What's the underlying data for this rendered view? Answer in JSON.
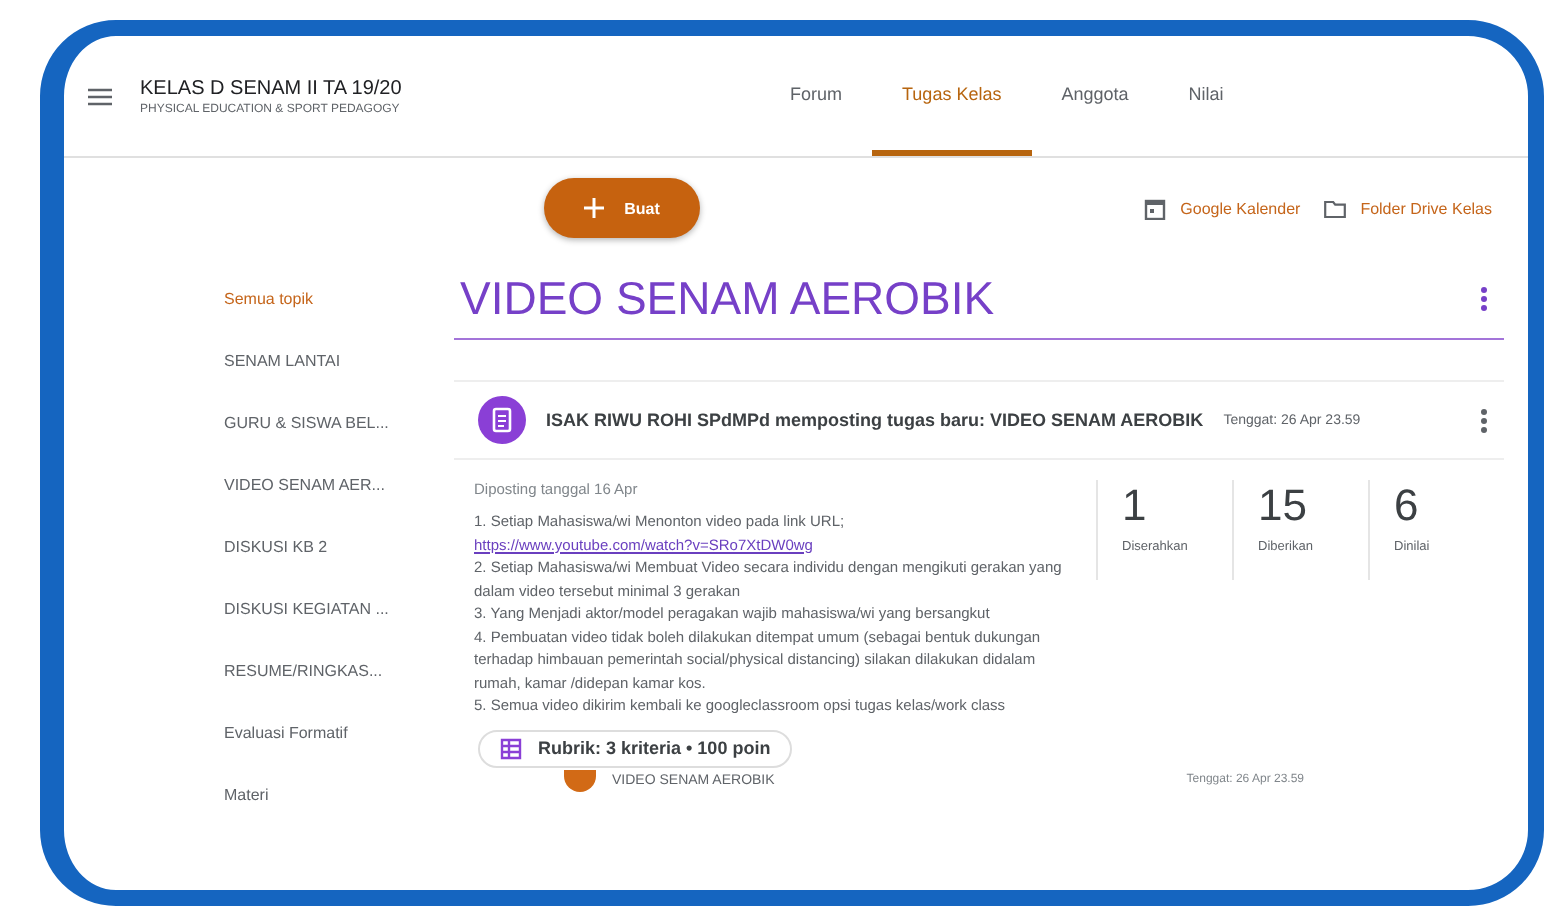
{
  "header": {
    "class_title": "KELAS D SENAM II TA 19/20",
    "class_subtitle": "PHYSICAL EDUCATION & SPORT PEDAGOGY",
    "tabs": [
      {
        "label": "Forum",
        "selected": false
      },
      {
        "label": "Tugas Kelas",
        "selected": true
      },
      {
        "label": "Anggota",
        "selected": false
      },
      {
        "label": "Nilai",
        "selected": false
      }
    ]
  },
  "toolbar": {
    "create_button": "Buat",
    "calendar_link": "Google Kalender",
    "drive_link": "Folder Drive Kelas"
  },
  "topics": [
    {
      "label": "Semua topik",
      "selected": true
    },
    {
      "label": "SENAM LANTAI",
      "selected": false
    },
    {
      "label": "GURU & SISWA BEL...",
      "selected": false
    },
    {
      "label": "VIDEO SENAM AER...",
      "selected": false
    },
    {
      "label": "DISKUSI KB 2",
      "selected": false
    },
    {
      "label": "DISKUSI KEGIATAN ...",
      "selected": false
    },
    {
      "label": "RESUME/RINGKAS...",
      "selected": false
    },
    {
      "label": "Evaluasi Formatif",
      "selected": false
    },
    {
      "label": "Materi",
      "selected": false
    }
  ],
  "topic_title": "VIDEO SENAM AEROBIK",
  "assignment": {
    "author_line": "ISAK RIWU ROHI SPdMPd memposting tugas baru: VIDEO SENAM AEROBIK",
    "due": "Tenggat: 26 Apr 23.59",
    "posted": "Diposting tanggal 16 Apr",
    "body": [
      {
        "kind": "text",
        "text": "1. Setiap Mahasiswa/wi Menonton video pada link URL;"
      },
      {
        "kind": "link",
        "text": "https://www.youtube.com/watch?v=SRo7XtDW0wg"
      },
      {
        "kind": "text",
        "text": "2. Setiap Mahasiswa/wi Membuat Video secara individu dengan mengikuti gerakan yang dalam video tersebut minimal 3 gerakan"
      },
      {
        "kind": "text",
        "text": "3. Yang Menjadi aktor/model peragakan wajib mahasiswa/wi yang bersangkut"
      },
      {
        "kind": "text",
        "text": "4. Pembuatan video tidak boleh dilakukan ditempat umum (sebagai bentuk dukungan terhadap himbauan pemerintah social/physical distancing) silakan dilakukan didalam rumah, kamar /didepan kamar kos."
      },
      {
        "kind": "text",
        "text": "5. Semua video dikirim kembali ke googleclassroom opsi tugas kelas/work class"
      }
    ],
    "stats": [
      {
        "value": "1",
        "label": "Diserahkan"
      },
      {
        "value": "15",
        "label": "Diberikan"
      },
      {
        "value": "6",
        "label": "Dinilai"
      }
    ],
    "rubric": "Rubrik: 3 kriteria • 100 poin"
  },
  "next_assignment": {
    "title": "VIDEO SENAM AEROBIK",
    "due": "Tenggat: 26 Apr 23.59"
  }
}
